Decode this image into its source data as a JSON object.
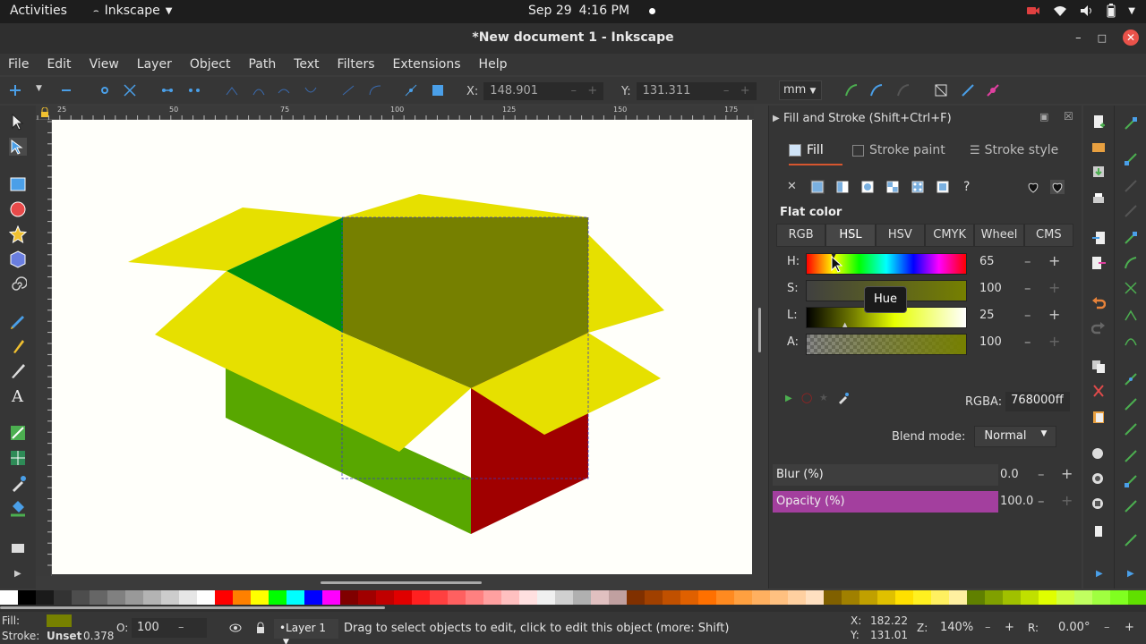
{
  "topbar": {
    "activities": "Activities",
    "app_name": "Inkscape",
    "date": "Sep 29",
    "time": "4:16 PM"
  },
  "window": {
    "title": "*New document 1 - Inkscape"
  },
  "menu": [
    "File",
    "Edit",
    "View",
    "Layer",
    "Object",
    "Path",
    "Text",
    "Filters",
    "Extensions",
    "Help"
  ],
  "toolbar": {
    "x_label": "X:",
    "x_value": "148.901",
    "y_label": "Y:",
    "y_value": "131.311",
    "unit": "mm"
  },
  "ruler": {
    "h_labels": [
      "25",
      "50",
      "75",
      "100",
      "125",
      "150",
      "175"
    ]
  },
  "dock": {
    "title": "Fill and Stroke (Shift+Ctrl+F)",
    "tabs": [
      "Fill",
      "Stroke paint",
      "Stroke style"
    ],
    "paint_type": "Flat color",
    "modes": [
      "RGB",
      "HSL",
      "HSV",
      "CMYK",
      "Wheel",
      "CMS"
    ],
    "active_mode": "HSL",
    "sliders": [
      {
        "label": "H:",
        "value": "65"
      },
      {
        "label": "S:",
        "value": "100"
      },
      {
        "label": "L:",
        "value": "25"
      },
      {
        "label": "A:",
        "value": "100"
      }
    ],
    "tooltip": "Hue",
    "rgba_label": "RGBA:",
    "rgba_value": "768000ff",
    "blend_label": "Blend mode:",
    "blend_value": "Normal",
    "blur_label": "Blur (%)",
    "blur_value": "0.0",
    "opacity_label": "Opacity (%)",
    "opacity_value": "100.0"
  },
  "colors": {
    "current_fill": "#768000",
    "accent": "#d6562f",
    "opacity_bar": "#a33f9e"
  },
  "status": {
    "fill_label": "Fill:",
    "stroke_label": "Stroke:",
    "stroke_value": "Unset",
    "stroke_width": "0.378",
    "o_label": "O:",
    "o_value": "100",
    "layer": "•Layer 1",
    "message": "Drag to select objects to edit, click to edit this object (more: Shift)",
    "cx_label": "X:",
    "cx": "182.22",
    "cy_label": "Y:",
    "cy": "131.01",
    "z_label": "Z:",
    "zoom": "140%",
    "r_label": "R:",
    "rotation": "0.00°"
  }
}
